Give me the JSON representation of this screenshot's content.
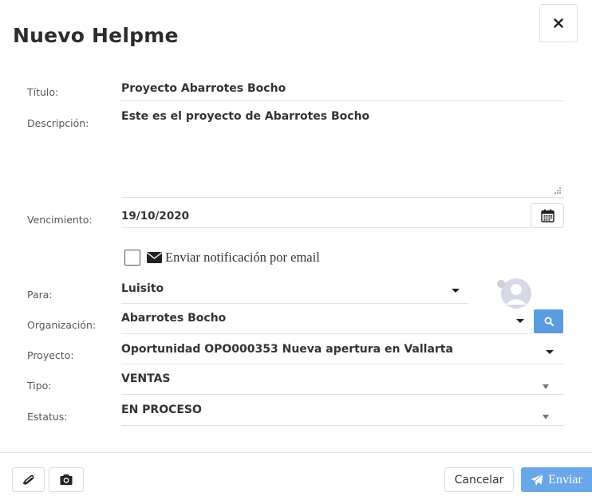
{
  "dialog": {
    "title": "Nuevo Helpme",
    "close_icon": "close-icon"
  },
  "form": {
    "titulo": {
      "label": "Título:",
      "value": "Proyecto Abarrotes Bocho"
    },
    "descripcion": {
      "label": "Descripción:",
      "value": "Este es el proyecto de Abarrotes Bocho"
    },
    "vencimiento": {
      "label": "Vencimiento:",
      "value": "19/10/2020",
      "icon": "calendar-icon"
    },
    "notificacion": {
      "label": "Enviar notificación por email",
      "checked": false,
      "icon": "envelope-icon"
    },
    "para": {
      "label": "Para:",
      "value": "Luisito",
      "avatar_icon": "user-avatar-icon"
    },
    "organizacion": {
      "label": "Organización:",
      "value": "Abarrotes Bocho",
      "search_icon": "search-icon"
    },
    "proyecto": {
      "label": "Proyecto:",
      "value": "Oportunidad OPO000353 Nueva apertura en Vallarta"
    },
    "tipo": {
      "label": "Tipo:",
      "value": "VENTAS"
    },
    "estatus": {
      "label": "Estatus:",
      "value": "EN PROCESO"
    }
  },
  "footer": {
    "attach_icon": "paperclip-icon",
    "camera_icon": "camera-icon",
    "cancel_label": "Cancelar",
    "send_label": "Enviar",
    "send_icon": "paper-plane-icon"
  },
  "colors": {
    "primary": "#6aa7e8",
    "search_button": "#5b9ce0",
    "text": "#333333",
    "label": "#555555",
    "rule": "#e2e2e2"
  }
}
